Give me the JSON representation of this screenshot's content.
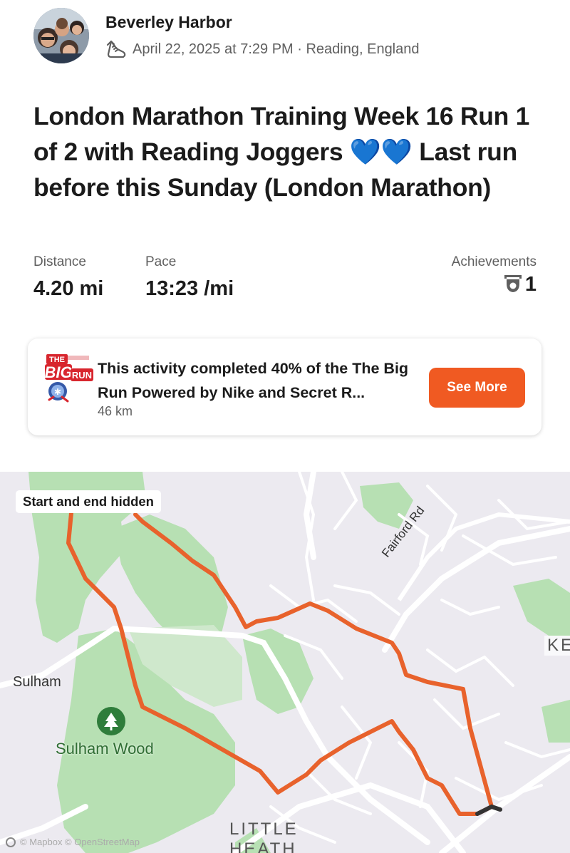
{
  "athlete": {
    "name": "Beverley Harbor",
    "date": "April 22, 2025 at 7:29 PM",
    "separator": " · ",
    "location": "Reading, England",
    "activity_icon": "running-shoe-icon"
  },
  "activity": {
    "title": "London Marathon Training Week 16 Run 1 of 2 with Reading Joggers 💙💙 Last run before this Sunday (London Marathon)"
  },
  "stats": {
    "distance": {
      "label": "Distance",
      "value": "4.20 mi"
    },
    "pace": {
      "label": "Pace",
      "value": "13:23 /mi"
    },
    "achievements": {
      "label": "Achievements",
      "value": "1",
      "icon": "trophy-icon"
    }
  },
  "challenge": {
    "badge_text_top": "THE",
    "badge_text_big": "BIG",
    "badge_text_run": "RUN",
    "text": "This activity completed 40% of the The Big Run Powered by Nike and Secret R...",
    "progress_percent": 40,
    "distance": "46 km",
    "button_label": "See More"
  },
  "map": {
    "overlay_label": "Start and end hidden",
    "road_label": "Fairford Rd",
    "labels": {
      "sulham": "Sulham",
      "sulham_wood": "Sulham Wood",
      "little": "LITTLE",
      "heath": "HEATH",
      "ke": "KE"
    },
    "attribution": "© Mapbox © OpenStreetMap",
    "route_color": "#e8622c",
    "park_color": "#b7e0b3"
  }
}
